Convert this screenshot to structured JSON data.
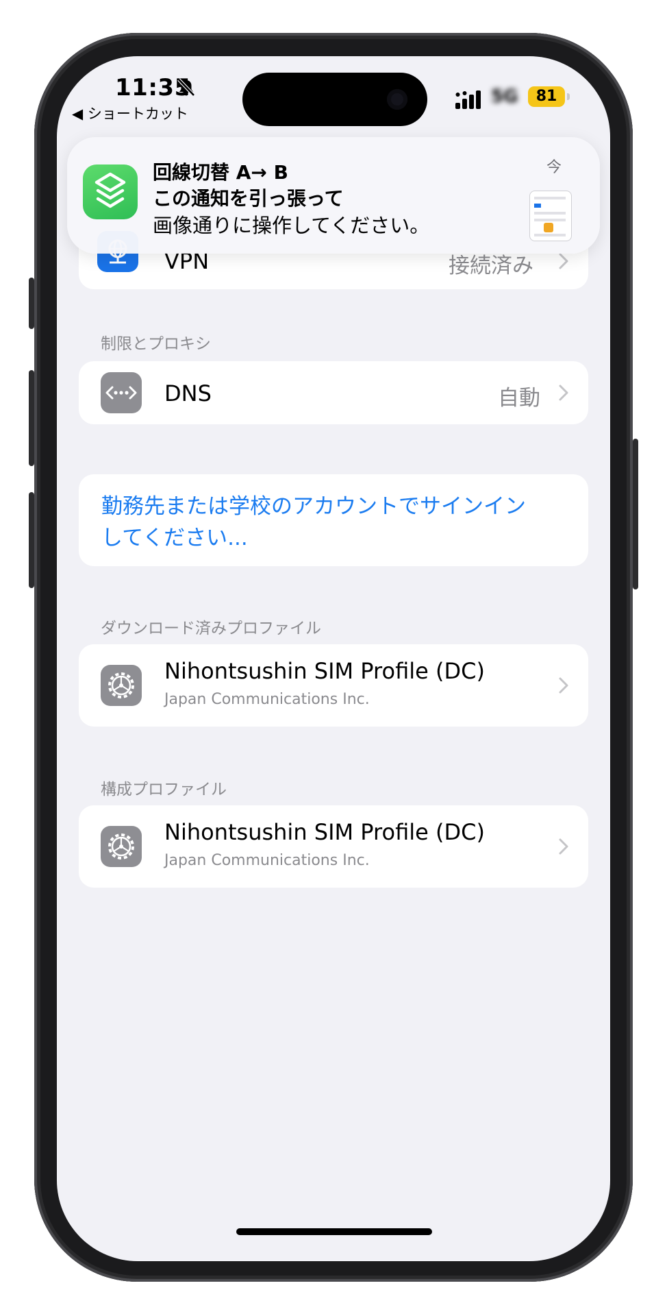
{
  "status_bar": {
    "time": "11:35",
    "back_label": "◀ ショートカット",
    "network": "5G",
    "battery": "81"
  },
  "notification": {
    "title": "回線切替 A→ B",
    "line1": "この通知を引っ張って",
    "line2": "画像通りに操作してください。",
    "time": "今",
    "app_icon": "shortcuts-icon"
  },
  "vpn": {
    "label": "VPN",
    "value": "接続済み"
  },
  "proxy_section": {
    "header": "制限とプロキシ",
    "dns_label": "DNS",
    "dns_value": "自動"
  },
  "signin": {
    "line1": "勤務先または学校のアカウントでサインイン",
    "line2": "してください..."
  },
  "downloaded_section": {
    "header": "ダウンロード済みプロファイル",
    "title": "Nihontsushin SIM Profile (DC)",
    "subtitle": "Japan Communications Inc."
  },
  "config_section": {
    "header": "構成プロファイル",
    "title": "Nihontsushin SIM Profile (DC)",
    "subtitle": "Japan Communications Inc."
  },
  "colors": {
    "accent": "#1b7cf0",
    "background": "#f1f1f6",
    "battery": "#f5c518",
    "shortcuts_green": "#34c759"
  }
}
